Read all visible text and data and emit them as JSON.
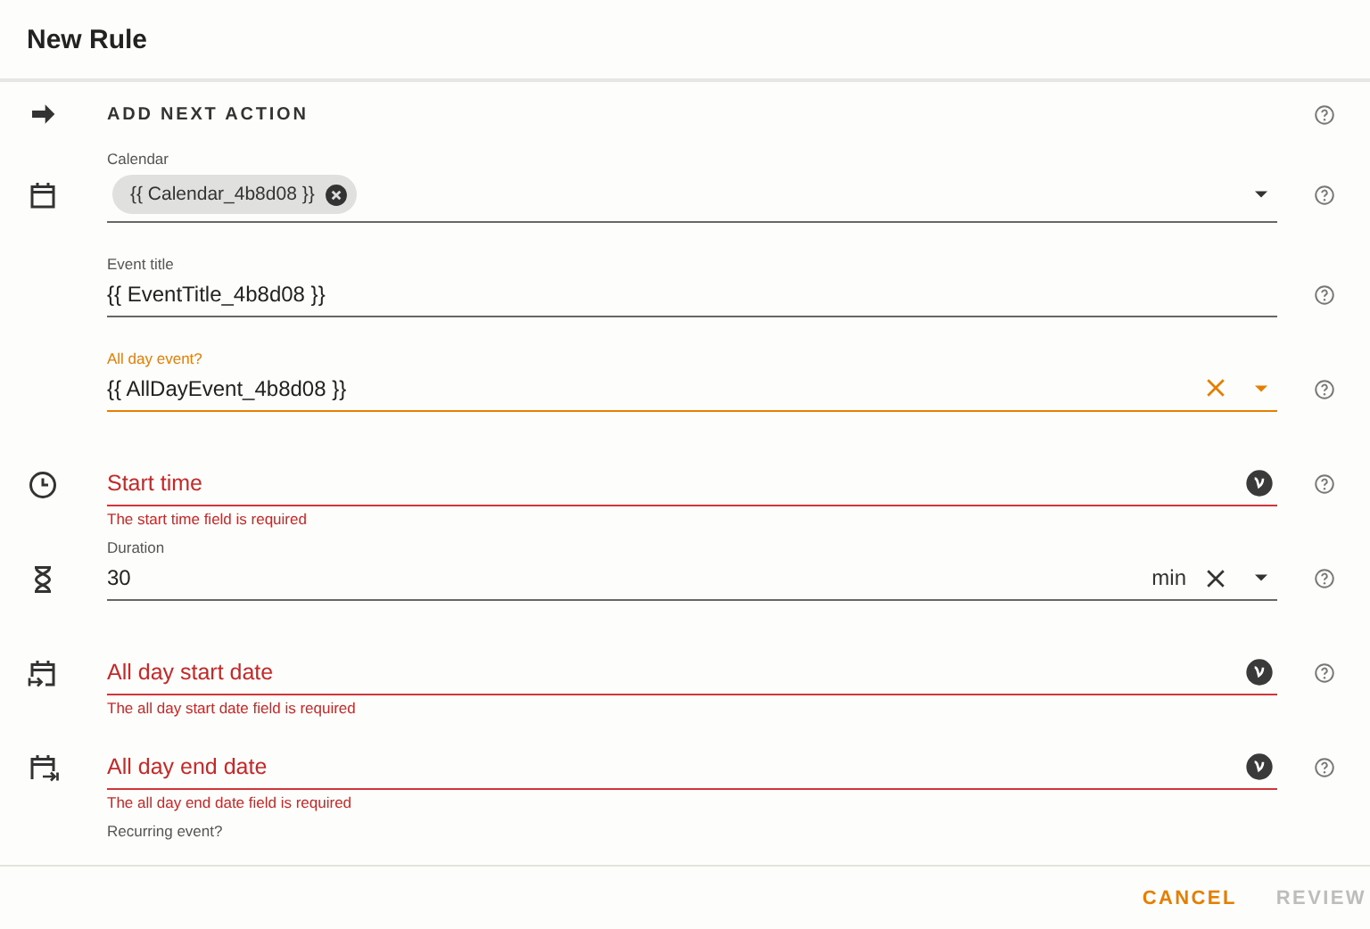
{
  "dialog": {
    "title": "New Rule"
  },
  "section": {
    "title": "ADD NEXT ACTION"
  },
  "fields": [
    {
      "label": "Calendar",
      "chip": "{{ Calendar_4b8d08 }}",
      "focused": false,
      "invalid": false,
      "clear": false,
      "dropdown": true,
      "variable": false
    },
    {
      "label": "Event title",
      "value": "{{ EventTitle_4b8d08 }}",
      "focused": false,
      "invalid": false,
      "clear": false,
      "dropdown": false,
      "variable": false
    },
    {
      "label": "All day event?",
      "value": "{{ AllDayEvent_4b8d08 }}",
      "focused": true,
      "invalid": false,
      "clear": true,
      "dropdown": true,
      "variable": false
    },
    {
      "placeholder": "Start time",
      "error": "The start time field is required",
      "focused": false,
      "invalid": true,
      "clear": false,
      "dropdown": false,
      "variable": true
    },
    {
      "label": "Duration",
      "value": "30",
      "unit": "min",
      "focused": false,
      "invalid": false,
      "clear": true,
      "dropdown": true,
      "variable": false
    },
    {
      "placeholder": "All day start date",
      "error": "The all day start date field is required",
      "focused": false,
      "invalid": true,
      "clear": false,
      "dropdown": false,
      "variable": true
    },
    {
      "placeholder": "All day end date",
      "error": "The all day end date field is required",
      "focused": false,
      "invalid": true,
      "clear": false,
      "dropdown": false,
      "variable": true
    },
    {
      "label": "Recurring event?"
    }
  ],
  "buttons": [
    {
      "label": "CANCEL",
      "disabled": false
    },
    {
      "label": "REVIEW",
      "disabled": true
    }
  ]
}
